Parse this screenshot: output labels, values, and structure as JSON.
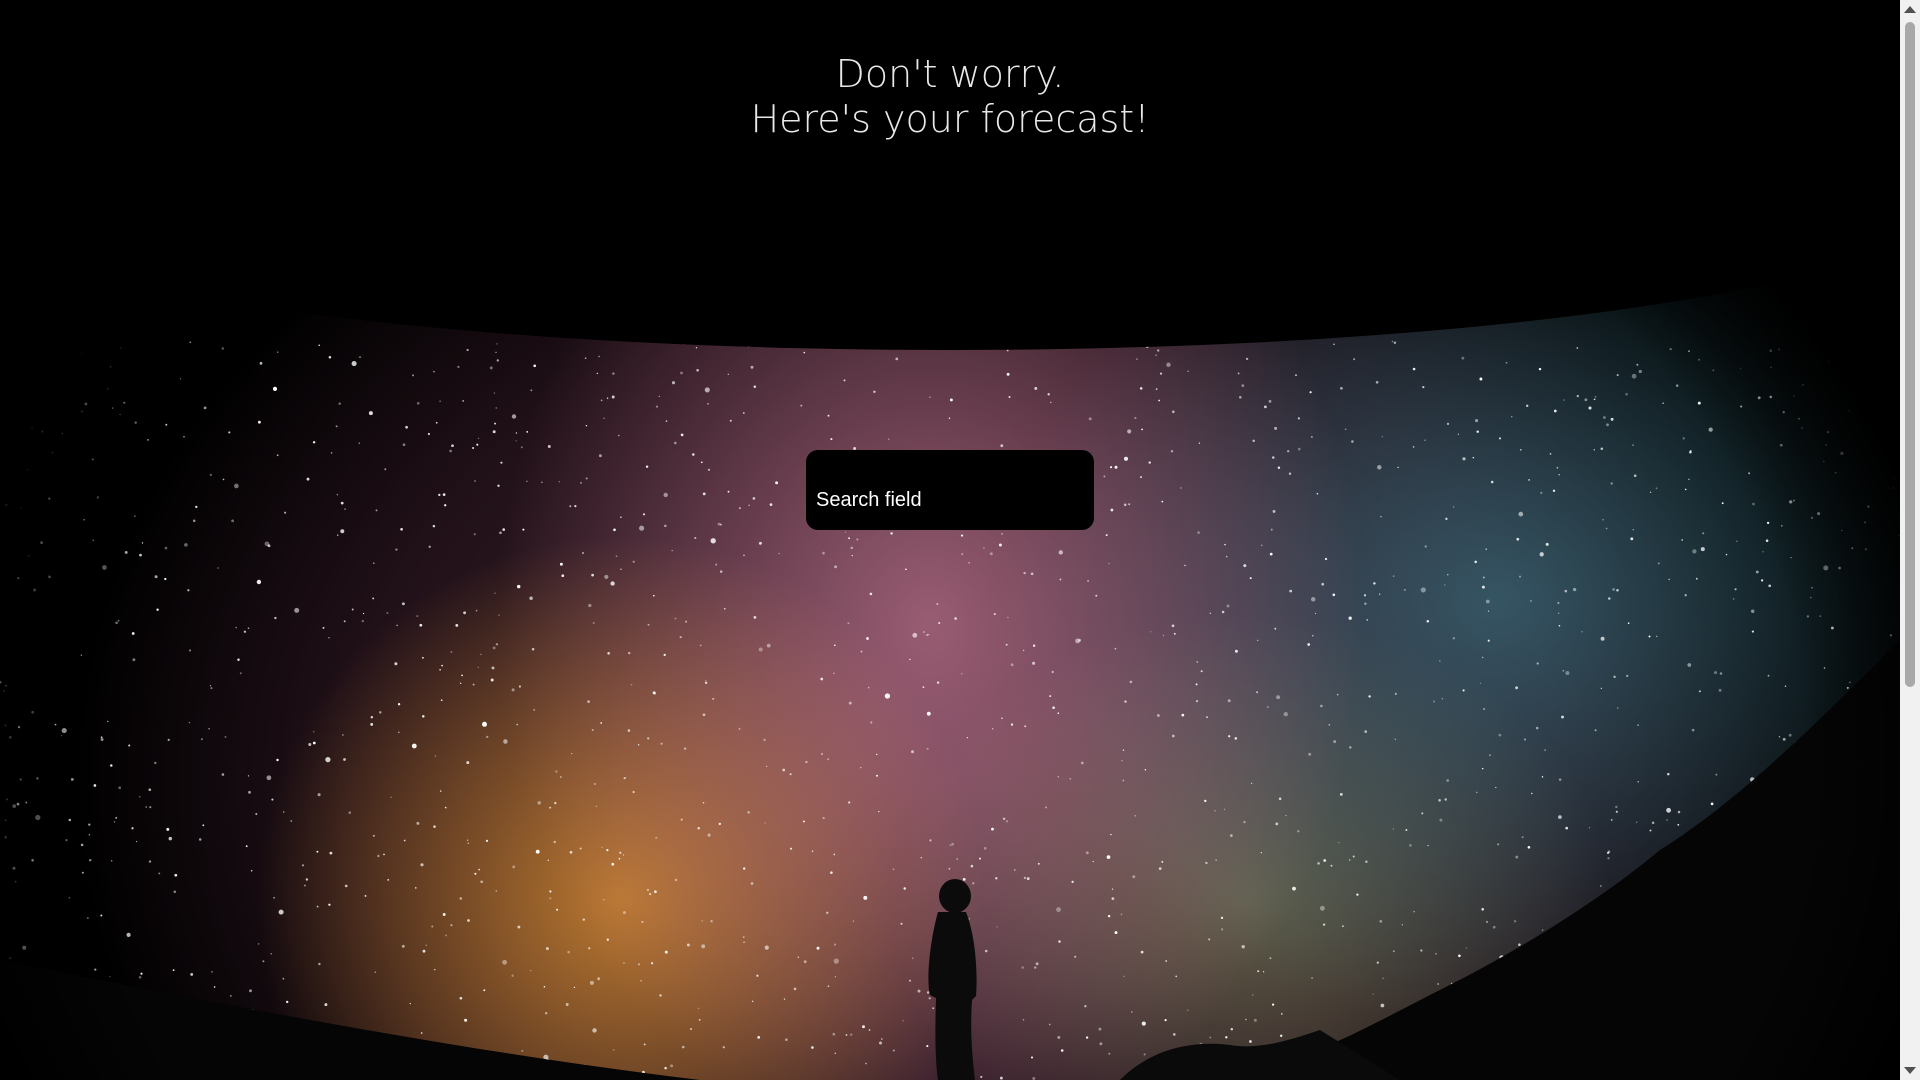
{
  "header": {
    "line1": "Don't worry.",
    "line2": "Here's your forecast!"
  },
  "search": {
    "placeholder": "Search field"
  },
  "colors": {
    "header_band": "#000000",
    "search_bg": "#000000",
    "text": "#e8e8e8"
  }
}
